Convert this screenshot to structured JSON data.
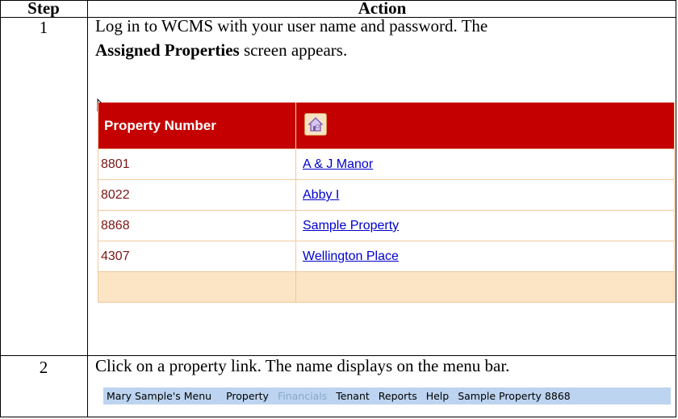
{
  "headers": {
    "step": "Step",
    "action": "Action"
  },
  "steps": [
    {
      "number": "1",
      "line1": "Log in to WCMS with your user name and password. The",
      "line2_bold": "Assigned Properties",
      "line2_rest": " screen appears."
    },
    {
      "number": "2",
      "line1": "Click on a property link. The name displays on the menu bar."
    }
  ],
  "property_table": {
    "header": "Property Number",
    "header_icon": "home-icon",
    "rows": [
      {
        "number": "8801",
        "name": "A & J Manor"
      },
      {
        "number": "8022",
        "name": "Abby I"
      },
      {
        "number": "8868",
        "name": "Sample Property"
      },
      {
        "number": "4307",
        "name": "Wellington Place"
      }
    ]
  },
  "menu_bar": {
    "items": [
      "Mary Sample's Menu",
      "Property",
      "Financials",
      "Tenant",
      "Reports",
      "Help",
      "Sample Property 8868"
    ],
    "disabled": [
      "Financials"
    ]
  },
  "colors": {
    "header_red": "#c40000",
    "link_blue": "#0000cc",
    "row_number_red": "#7a1616",
    "footer_row": "#fbe5c4",
    "menu_bar": "#bcd4ef",
    "menu_disabled": "#8aa6cc"
  }
}
